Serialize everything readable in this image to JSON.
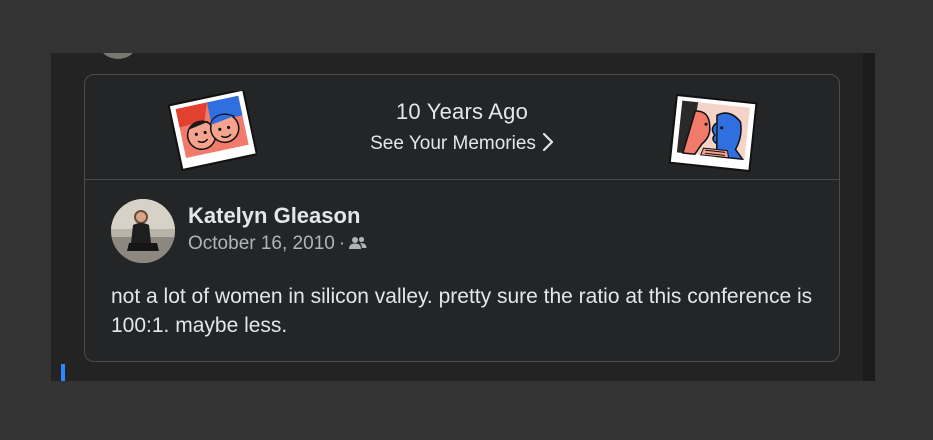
{
  "memory": {
    "title": "10 Years Ago",
    "link_label": "See Your Memories",
    "icons": [
      "chevron-right-icon",
      "memory-photo-illustration",
      "friends-icon"
    ]
  },
  "post": {
    "author": "Katelyn Gleason",
    "date": "October 16, 2010",
    "separator": "·",
    "audience_icon": "friends-icon",
    "body": "not a lot of women in silicon valley. pretty sure the ratio at this conference is 100:1. maybe less."
  },
  "colors": {
    "page_background": "#333333",
    "card_background": "#242526",
    "primary_text": "#e4e6eb",
    "secondary_text": "#b0b3b8",
    "accent_blue": "#2d88ff"
  }
}
